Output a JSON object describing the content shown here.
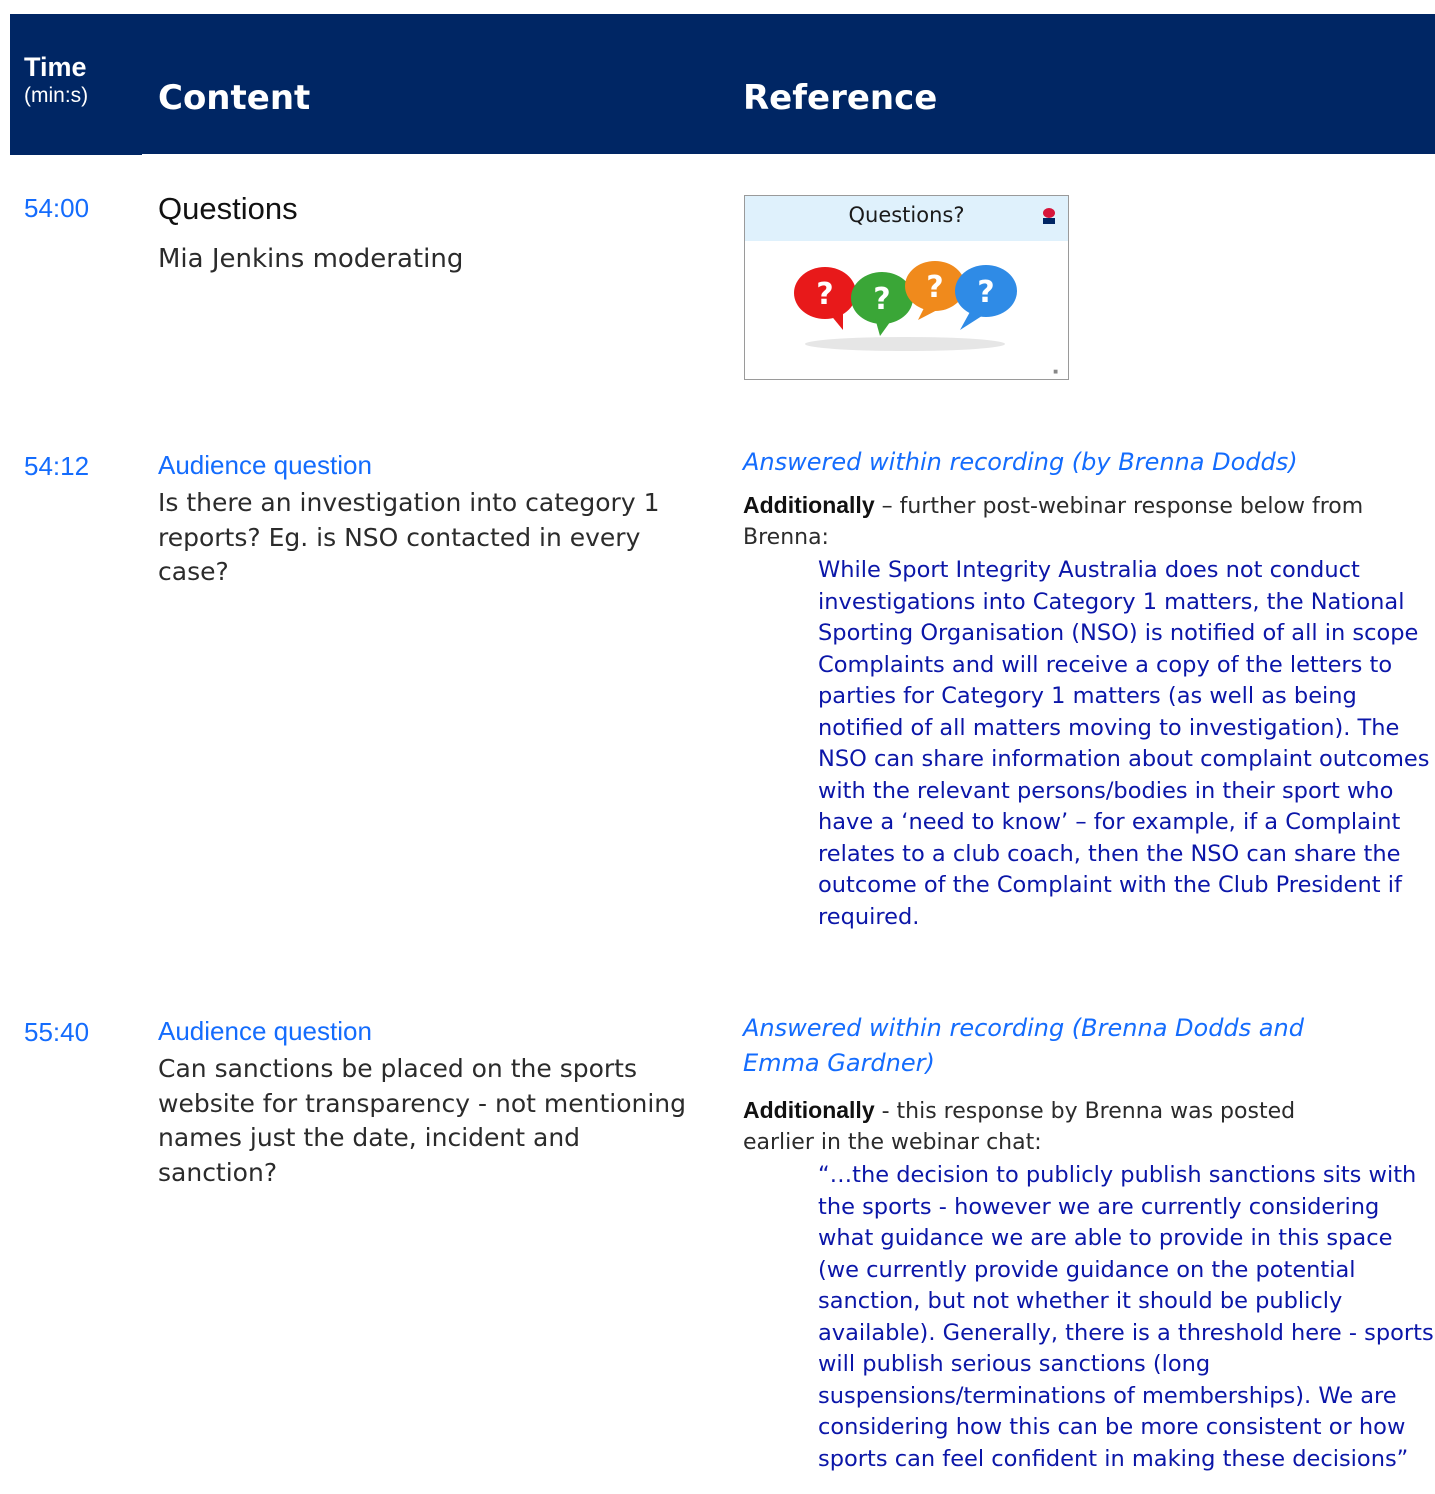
{
  "header": {
    "time_title": "Time",
    "time_unit": "(min:s)",
    "content_title": "Content",
    "reference_title": "Reference",
    "background_color": "#002664"
  },
  "rows": [
    {
      "time": "54:00",
      "title": "Questions",
      "subtitle": "Mia Jenkins moderating",
      "slide": {
        "title": "Questions?",
        "bubbles": [
          "?",
          "?",
          "?",
          "?"
        ],
        "logo": "nsw-waratah-icon"
      }
    },
    {
      "time": "54:12",
      "question_label": "Audience question",
      "question": "Is there an investigation into category 1 reports?  Eg. is NSO contacted in every case?",
      "answered": "Answered within recording (by Brenna Dodds)",
      "additionally_label": "Additionally",
      "additionally_text": " – further post-webinar response below from Brenna:",
      "response": "While Sport Integrity Australia does not conduct investigations into Category 1 matters, the National Sporting Organisation (NSO) is notified of all in scope Complaints and will receive a copy of the letters to parties for Category 1 matters (as well as being notified of all matters moving to investigation). The NSO can share information about complaint outcomes with the relevant persons/bodies in their sport who have a ‘need to know’ – for example, if a Complaint relates to a club coach, then the NSO can share the outcome of the Complaint with the Club President if required."
    },
    {
      "time": "55:40",
      "question_label": "Audience question",
      "question": "Can sanctions be placed on the sports website for transparency - not mentioning names just the date, incident and sanction?",
      "answered": "Answered within recording (Brenna Dodds and Emma Gardner)",
      "additionally_label": "Additionally",
      "additionally_text": " - this response by Brenna was posted earlier in the webinar chat:",
      "response": "“…the decision to publicly publish sanctions sits with the sports - however we are currently considering what guidance we are able to provide in this space (we currently provide guidance on the potential sanction, but not whether it should be publicly available). Generally, there is a threshold here - sports will publish serious sanctions (long suspensions/terminations of memberships). We are considering how this can be more consistent or how sports can feel confident in making these decisions”"
    }
  ],
  "colors": {
    "accent_blue": "#146cfd",
    "quote_blue": "#0b16a8",
    "bubble_colors": [
      "#e8191a",
      "#3aa637",
      "#f08a1c",
      "#2f8be6"
    ]
  }
}
